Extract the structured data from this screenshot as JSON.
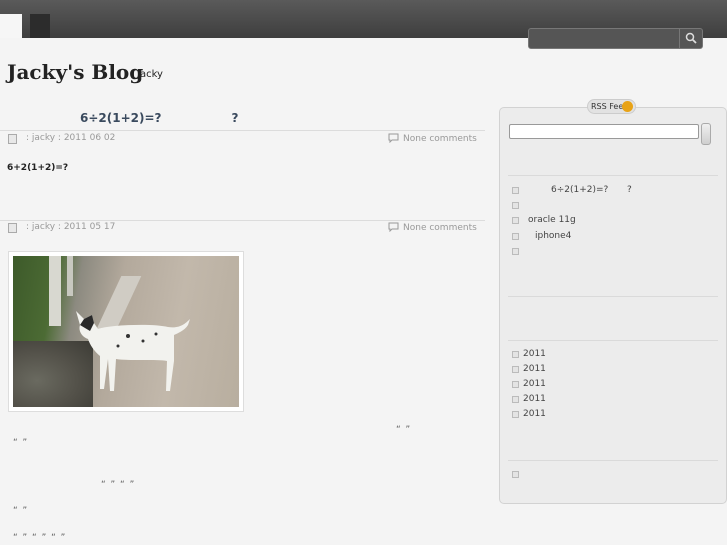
{
  "header": {
    "title": "Jacky's Blog",
    "subtitle": "Jacky",
    "search_placeholder": ""
  },
  "posts": [
    {
      "title": "6÷2(1+2)=?",
      "title_suffix": "?",
      "meta": ": jacky   : 2011   06   02",
      "comments": "None comments",
      "excerpt": "6+2(1+2)=?"
    },
    {
      "meta": ": jacky   : 2011   05   17",
      "comments": "None comments"
    }
  ],
  "body_fragments": [
    "“  ”",
    "“  ”",
    "“  ”        “ ”",
    "“ ”",
    "“             ”            “ ”                       “                                   ”"
  ],
  "sidebar": {
    "rss_label": "RSS Feed",
    "recent_posts": [
      "6÷2(1+2)=?",
      "?",
      "oracle 11g",
      "iphone4"
    ],
    "archives": [
      "2011",
      "2011",
      "2011",
      "2011",
      "2011"
    ]
  },
  "colors": {
    "topbar": "#3e3e3e",
    "title_link": "#3a4a5e",
    "rss": "#e8a317"
  },
  "icons": {
    "search": "search-icon",
    "comment": "comment-icon",
    "post": "document-icon",
    "rss": "rss-icon"
  }
}
